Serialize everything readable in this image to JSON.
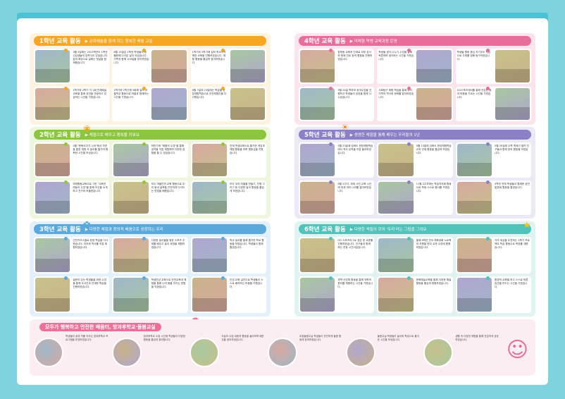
{
  "sections": [
    {
      "id": "g1",
      "title": "1학년 교육 활동",
      "subtitle": "▶ 문화예술을 함께 하는 행복한 배움 교실",
      "cards": [
        "3월 2일에는 2023학년도 1학년 신입생들의 입학식이 있었습니다. 꿈과 희망으로 설레는 첫날을 함께했습니다.",
        "6월 15일은 1학년 학생들이 동물원에 다녀온 날이 되었습니다. 가족과 함께 100일을 맞이하였습니다.",
        "1학기와 2학기에 걸쳐 학교폭력 예방 교육을 진행하였습니다. 체험 활동을 즐겁게 참여하였습니다.",
        "1학기와 2학기 각 1회 천재예술교육을 통해 공연을 관람하고 감상하는 시간을 가졌습니다.",
        "1학기와 2학기에 5회에 걸쳐 마을학교 활동으로 마을과 함께하는 시간을 가졌습니다.",
        "6월 7일과 23일에는 학급별 현장체험학습으로 안전체험관을 다녀왔습니다."
      ]
    },
    {
      "id": "g2",
      "title": "2학년 교육 활동",
      "subtitle": "▶ 체험으로 배우고 행복을 키워요",
      "cards": [
        "5월 \"문화도자기 나라\"에서 자연을 통한 체험 속 놀이를 즐기며 행복한 시간을 보냈습니다.",
        "하반기에 \"체험의 수업\"을 통해 공작을 직접 체험하며 다양한 경험을 할 수 있었습니다.",
        "전체 학생교육으로 즐거운 게임과 체험 활동을 하며 협동심을 키웠습니다.",
        "또래활동교육으로 그린 \"교육전래놀이 수업\"을 통해 자신을 소개하고 친구와 어울렸습니다.",
        "모두 마을안전 교육 활동으로 우리 동네 골목을 안전하게 다녀오는 방법을 배웠습니다.",
        "모두 우리 마을을 만들기, 인형 그리기 등 다양한 놀이 활동을 즐겁게 하였습니다."
      ]
    },
    {
      "id": "g3",
      "title": "3학년 교육 활동",
      "subtitle": "▶ 다양한 체험과 창의적 배움으로 성장하는 우리",
      "cards": [
        "인천키즈스쿨로 현장 학습을 다녀왔습니다. 지리와 역사를 직접 체험하였습니다.",
        "다양한 놀이들을 위한 스포츠 주제를 배우고 놀이 과정을 체험하였습니다.",
        "학교 놀이를 통해 즐거운 학교 활동을 하였습니다. 학생들이 함께 즐겼습니다.",
        "질문이 있는 학생들을 위한 수업을 통해 도서관과 연계한 학습을 진행하였습니다.",
        "학생건강 교육으로 안전교육과 체험을 통해 나의 몸을 지키는 방법을 익혔습니다.",
        "인성 교육 실천으로 학생들이 스스로 배려하는 마음을 키웠습니다."
      ]
    },
    {
      "id": "g4",
      "title": "4학년 교육 활동",
      "subtitle": "▶ 미래형 역량 교육과정 운영",
      "cards": [
        "창체동 교육과 단계로 외부 강사와 함께 진로 탐색 활동을 진행하였습니다.",
        "학생들 생각 나누기 수업을 통해 토론하며 생각하는 시간을 가졌습니다.",
        "학생들 활동 중심 자기주도 학습으로 주제를 정해 탐구하였습니다.",
        "5월 24일 학부모 공개수업을 진행하고 학생들의 성장을 함께 나누었습니다.",
        "사회탐구 체험 학습을 통해 우리 지역의 역사와 문화를 알아보았습니다.",
        "GO스포츠데이를 통해 건강한 몸과 마음을 기르는 시간을 가졌습니다."
      ]
    },
    {
      "id": "g5",
      "title": "5학년 교육 활동",
      "subtitle": "▶ 생생한 체험을 통해 배우는 우리들의 1년",
      "cards": [
        "5월 23일에 강화도 현장체험학습에서 역사 유적을 직접 둘러보았습니다.",
        "5월 23일에 강화도 현장체험학습 교과 연계 활동을 즐겁게 하였습니다.",
        "5월 20일에 수학 축제가 열려 친구들과 함께 창의 활동을 하였습니다.",
        "6월 2주차, 세계 시민 교육 시간에 세계 여러 나라를 알아보았습니다.",
        "11월 2주차에는 학급자치회 활동으로 학생 스스로 행사를 꾸몄습니다.",
        "5학년 전체 학생들이 함께한 공연 발표회 활동을 즐겼습니다."
      ]
    },
    {
      "id": "g6",
      "title": "6학년 교육 활동",
      "subtitle": "▶ 다양한 색들이 모여 '우리'라는 그림을 그려요",
      "cards": [
        "GO 스포츠리그로 공은 한 교류를 진행하였습니다. 친구들과 함께 하는 운동 시간이었습니다.",
        "올해 6학년 전국 체육대회 노트북의 지원을 받아 교과 수업에 활용하였습니다.",
        "각자 세상을 도전하는 1학기 프로젝트 학습 활동으로 목표를 세웠습니다.",
        "과학 산업체 활동을 통해 과학의 원리를 체험하는 시간을 가졌습니다.",
        "문화예술교육을 통해 다양한 예술 활동을 즐겁게 체험하였습니다.",
        "환경적 교육을 하고 스스로 바른 습관을 만드는 시간을 가졌습니다."
      ]
    }
  ],
  "bottom": {
    "title": "모두가 행복하고 안전한 배움터, 방과후학교·돌봄교실",
    "items": [
      "학생들의 꿈과 끼를 키우는 방과후학교 프로그램을 운영하였습니다.",
      "방과후학교 수업 시간에 학생들이 다양한 활동을 즐겁게 참여합니다.",
      "오늘의 수업 내용과 활동을 돌아보며 배운 것을 정리하였습니다.",
      "초등돌봄교실 학생들이 안전하게 돌봄 활동에 참여하였습니다.",
      "돌봄교실 학생들이 놀이와 학습으로 즐거운 시간을 보냈습니다.",
      "생활 속 다양한 체험을 통해 건강하게 성장하였습니다."
    ]
  },
  "colors": {
    "g1": "#f6a623",
    "g1bg": "#fef3df",
    "g2": "#8cc63f",
    "g2bg": "#eef6dc",
    "g3": "#5aa9dd",
    "g3bg": "#e2f0fa",
    "g4": "#e86d9a",
    "g4bg": "#fbe4ee",
    "g5": "#8b7fc6",
    "g5bg": "#ece9f7",
    "g6": "#4fc2b9",
    "g6bg": "#dff3f1"
  },
  "icons": {
    "deco": [
      "butterfly-icon",
      "sun-icon",
      "flower-icon",
      "star-icon",
      "cloud-icon",
      "kids-icon"
    ]
  }
}
